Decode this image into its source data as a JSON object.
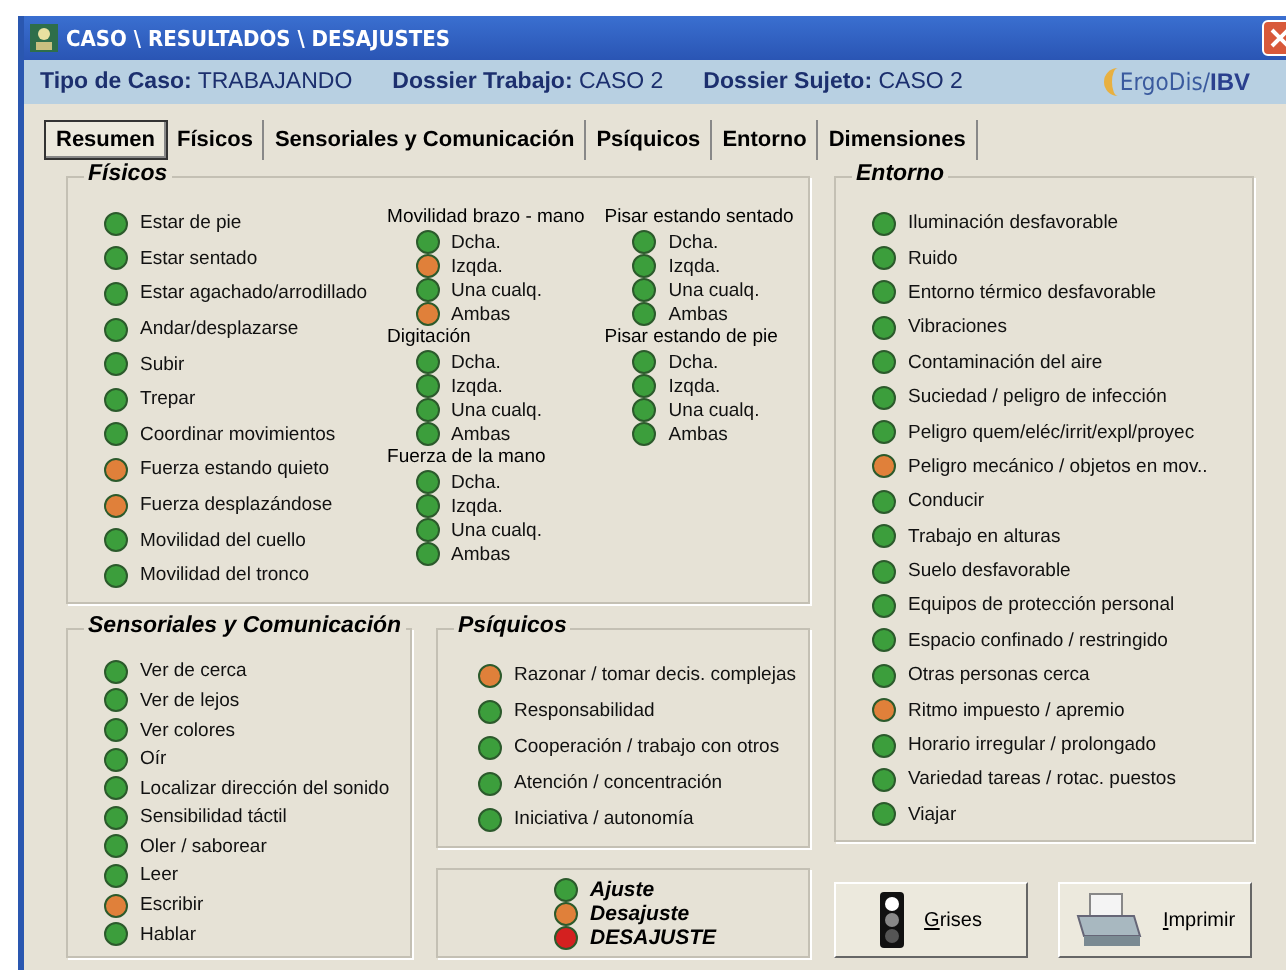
{
  "window": {
    "title": "CASO \\ RESULTADOS \\ DESAJUSTES"
  },
  "header": {
    "fields": [
      {
        "label": "Tipo de Caso:",
        "value": "TRABAJANDO"
      },
      {
        "label": "Dossier Trabajo:",
        "value": "CASO 2"
      },
      {
        "label": "Dossier Sujeto:",
        "value": "CASO 2"
      }
    ],
    "logo": {
      "left": "ErgoDis/",
      "right": "IBV"
    }
  },
  "tabs": [
    {
      "label": "Resumen",
      "selected": true
    },
    {
      "label": "Físicos",
      "selected": false
    },
    {
      "label": "Sensoriales y Comunicación",
      "selected": false
    },
    {
      "label": "Psíquicos",
      "selected": false
    },
    {
      "label": "Entorno",
      "selected": false
    },
    {
      "label": "Dimensiones",
      "selected": false
    }
  ],
  "fisicos": {
    "title": "Físicos",
    "items": [
      {
        "label": "Estar de pie",
        "color": "#3c9e3c"
      },
      {
        "label": "Estar sentado",
        "color": "#3c9e3c"
      },
      {
        "label": "Estar agachado/arrodillado",
        "color": "#3c9e3c"
      },
      {
        "label": "Andar/desplazarse",
        "color": "#3c9e3c"
      },
      {
        "label": "Subir",
        "color": "#3c9e3c"
      },
      {
        "label": "Trepar",
        "color": "#3c9e3c"
      },
      {
        "label": "Coordinar movimientos",
        "color": "#3c9e3c"
      },
      {
        "label": "Fuerza estando quieto",
        "color": "#e0803a"
      },
      {
        "label": "Fuerza desplazándose",
        "color": "#e0803a"
      },
      {
        "label": "Movilidad del cuello",
        "color": "#3c9e3c"
      },
      {
        "label": "Movilidad del tronco",
        "color": "#3c9e3c"
      }
    ],
    "group_columns": [
      [
        {
          "title": "Movilidad brazo - mano",
          "items": [
            {
              "label": "Dcha.",
              "color": "#3c9e3c"
            },
            {
              "label": "Izqda.",
              "color": "#e0803a"
            },
            {
              "label": "Una cualq.",
              "color": "#3c9e3c"
            },
            {
              "label": "Ambas",
              "color": "#e0803a"
            }
          ]
        },
        {
          "title": "Digitación",
          "items": [
            {
              "label": "Dcha.",
              "color": "#3c9e3c"
            },
            {
              "label": "Izqda.",
              "color": "#3c9e3c"
            },
            {
              "label": "Una cualq.",
              "color": "#3c9e3c"
            },
            {
              "label": "Ambas",
              "color": "#3c9e3c"
            }
          ]
        },
        {
          "title": "Fuerza de la mano",
          "items": [
            {
              "label": "Dcha.",
              "color": "#3c9e3c"
            },
            {
              "label": "Izqda.",
              "color": "#3c9e3c"
            },
            {
              "label": "Una cualq.",
              "color": "#3c9e3c"
            },
            {
              "label": "Ambas",
              "color": "#3c9e3c"
            }
          ]
        }
      ],
      [
        {
          "title": "Pisar estando sentado",
          "items": [
            {
              "label": "Dcha.",
              "color": "#3c9e3c"
            },
            {
              "label": "Izqda.",
              "color": "#3c9e3c"
            },
            {
              "label": "Una cualq.",
              "color": "#3c9e3c"
            },
            {
              "label": "Ambas",
              "color": "#3c9e3c"
            }
          ]
        },
        {
          "title": "Pisar estando de pie",
          "items": [
            {
              "label": "Dcha.",
              "color": "#3c9e3c"
            },
            {
              "label": "Izqda.",
              "color": "#3c9e3c"
            },
            {
              "label": "Una cualq.",
              "color": "#3c9e3c"
            },
            {
              "label": "Ambas",
              "color": "#3c9e3c"
            }
          ]
        }
      ]
    ]
  },
  "sensoriales": {
    "title": "Sensoriales y Comunicación",
    "items": [
      {
        "label": "Ver de cerca",
        "color": "#3c9e3c"
      },
      {
        "label": "Ver de lejos",
        "color": "#3c9e3c"
      },
      {
        "label": "Ver colores",
        "color": "#3c9e3c"
      },
      {
        "label": "Oír",
        "color": "#3c9e3c"
      },
      {
        "label": "Localizar dirección del sonido",
        "color": "#3c9e3c"
      },
      {
        "label": "Sensibilidad táctil",
        "color": "#3c9e3c"
      },
      {
        "label": "Oler / saborear",
        "color": "#3c9e3c"
      },
      {
        "label": "Leer",
        "color": "#3c9e3c"
      },
      {
        "label": "Escribir",
        "color": "#e0803a"
      },
      {
        "label": "Hablar",
        "color": "#3c9e3c"
      }
    ]
  },
  "psiquicos": {
    "title": "Psíquicos",
    "items": [
      {
        "label": "Razonar / tomar decis. complejas",
        "color": "#e0803a"
      },
      {
        "label": "Responsabilidad",
        "color": "#3c9e3c"
      },
      {
        "label": "Cooperación / trabajo con otros",
        "color": "#3c9e3c"
      },
      {
        "label": "Atención / concentración",
        "color": "#3c9e3c"
      },
      {
        "label": "Iniciativa / autonomía",
        "color": "#3c9e3c"
      }
    ]
  },
  "legend": [
    {
      "label": "Ajuste",
      "color": "#3c9e3c"
    },
    {
      "label": "Desajuste",
      "color": "#e0803a"
    },
    {
      "label": "DESAJUSTE",
      "color": "#d42020"
    }
  ],
  "entorno": {
    "title": "Entorno",
    "items": [
      {
        "label": "Iluminación desfavorable",
        "color": "#3c9e3c"
      },
      {
        "label": "Ruido",
        "color": "#3c9e3c"
      },
      {
        "label": "Entorno térmico desfavorable",
        "color": "#3c9e3c"
      },
      {
        "label": "Vibraciones",
        "color": "#3c9e3c"
      },
      {
        "label": "Contaminación del aire",
        "color": "#3c9e3c"
      },
      {
        "label": "Suciedad / peligro de infección",
        "color": "#3c9e3c"
      },
      {
        "label": "Peligro quem/eléc/irrit/expl/proyec",
        "color": "#3c9e3c"
      },
      {
        "label": "Peligro mecánico / objetos en mov..",
        "color": "#e0803a"
      },
      {
        "label": "Conducir",
        "color": "#3c9e3c"
      },
      {
        "label": "Trabajo en alturas",
        "color": "#3c9e3c"
      },
      {
        "label": "Suelo desfavorable",
        "color": "#3c9e3c"
      },
      {
        "label": "Equipos de protección personal",
        "color": "#3c9e3c"
      },
      {
        "label": "Espacio confinado / restringido",
        "color": "#3c9e3c"
      },
      {
        "label": "Otras personas cerca",
        "color": "#3c9e3c"
      },
      {
        "label": "Ritmo impuesto / apremio",
        "color": "#e0803a"
      },
      {
        "label": "Horario irregular / prolongado",
        "color": "#3c9e3c"
      },
      {
        "label": "Variedad tareas / rotac. puestos",
        "color": "#3c9e3c"
      },
      {
        "label": "Viajar",
        "color": "#3c9e3c"
      }
    ]
  },
  "buttons": [
    {
      "label": "Grises",
      "kind": "grey"
    },
    {
      "label": "Imprimir",
      "kind": "print"
    }
  ]
}
